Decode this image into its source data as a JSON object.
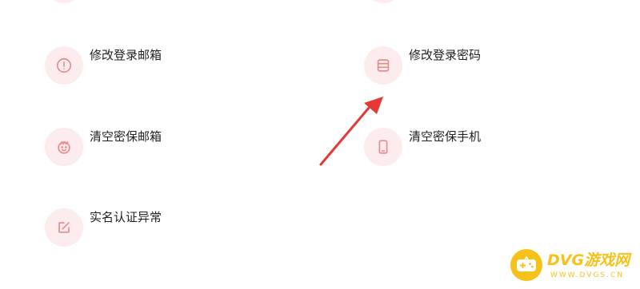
{
  "options": [
    {
      "label": "修改登录邮箱",
      "icon": "exclamation-circle-icon"
    },
    {
      "label": "修改登录密码",
      "icon": "stack-icon"
    },
    {
      "label": "清空密保邮箱",
      "icon": "face-icon"
    },
    {
      "label": "清空密保手机",
      "icon": "phone-icon"
    },
    {
      "label": "实名认证异常",
      "icon": "edit-square-icon"
    }
  ],
  "colors": {
    "icon_bg": "#fdeced",
    "icon_stroke": "#e8898d",
    "label_text": "#222222",
    "arrow": "#e53935",
    "watermark": "#f6c21a"
  },
  "watermark": {
    "brand": "DVG游戏网",
    "url": "WWW.DVGS.CN",
    "logo_icon": "gamepad-icon"
  }
}
